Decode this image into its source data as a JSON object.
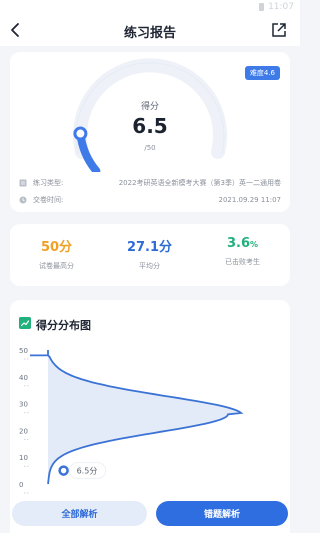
{
  "status_bar": {
    "time": "11:07"
  },
  "nav": {
    "title": "练习报告"
  },
  "score_card": {
    "difficulty": "难度4.6",
    "score_label": "得分",
    "score": "6.5",
    "score_total": "/50",
    "score_fraction": 0.13,
    "practice_type_label": "练习类型:",
    "practice_type_value": "2022考研英语全新模考大赛（第3季）英一二通用卷",
    "submit_time_label": "交卷时间:",
    "submit_time_value": "2021.09.29 11:07"
  },
  "stats": [
    {
      "value": "50分",
      "label": "试卷最高分",
      "color": "#f0a125"
    },
    {
      "value": "27.1分",
      "label": "平均分",
      "color": "#2f6bd6"
    },
    {
      "value": "3.6",
      "unit": "%",
      "label": "已击败考生",
      "color": "#22b07d"
    }
  ],
  "distribution": {
    "title": "得分分布图",
    "marker_label": "6.5分"
  },
  "chart_data": {
    "type": "area",
    "y_ticks": [
      "50",
      "40",
      "30",
      "20",
      "10",
      "0"
    ],
    "ylim": [
      0,
      50
    ],
    "marker_score": 6.5
  },
  "actions": {
    "all_analysis": "全部解析",
    "wrong_analysis": "错题解析"
  },
  "colors": {
    "primary": "#2f6ee0",
    "orange": "#f0a125",
    "green": "#22b07d"
  }
}
